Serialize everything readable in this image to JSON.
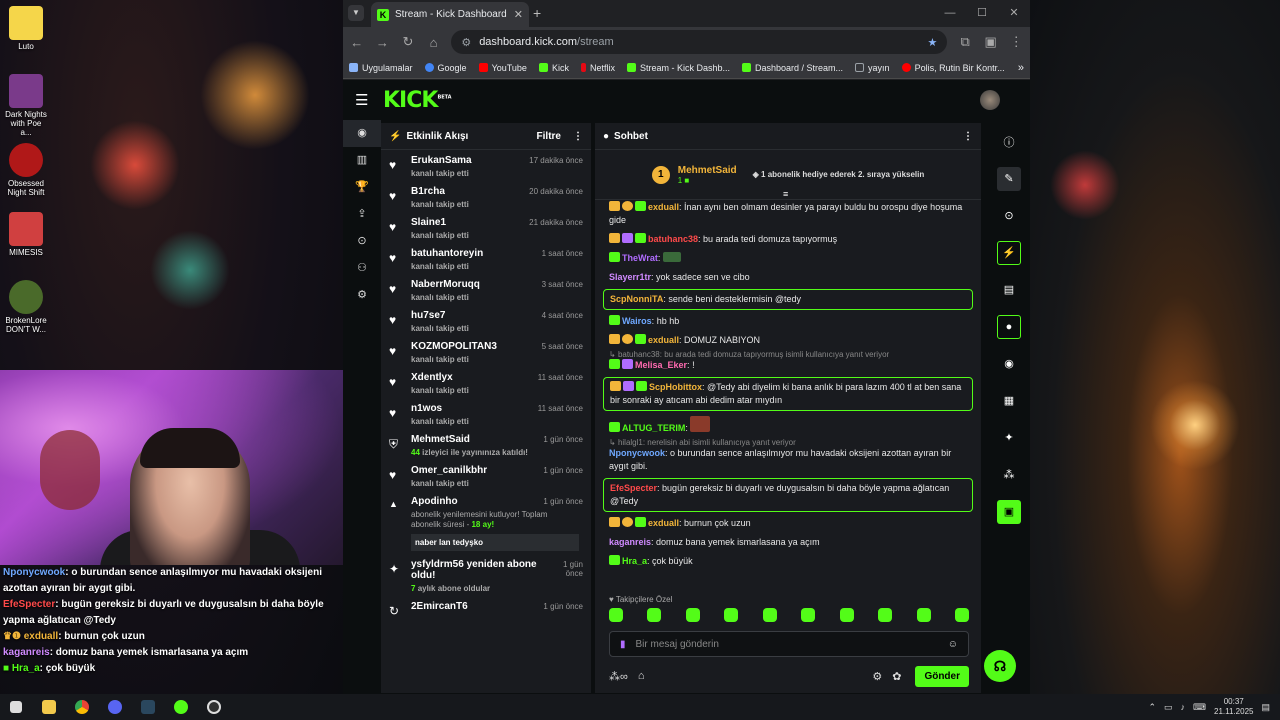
{
  "desktop": {
    "icons": [
      {
        "label": "Luto",
        "color": "#f5d64a"
      },
      {
        "label": "Dark Nights with Poe a...",
        "color": "#7a3a8a"
      },
      {
        "label": "Obsessed Night Shift",
        "color": "#b01818"
      },
      {
        "label": "MIMESIS",
        "color": "#d04040"
      },
      {
        "label": "BrokenLore DON'T W...",
        "color": "#4a6a2a"
      }
    ]
  },
  "overlay_chat": [
    {
      "user": "Nponycwook",
      "text": ": o burundan sence anlaşılmıyor mu havadaki oksijeni azottan ayıran bir aygıt gibi.",
      "color": "#6fa8ff"
    },
    {
      "user": "EfeSpecter",
      "text": ": bugün gereksiz bi duyarlı ve duygusalsın bi daha böyle yapma ağlatıcan @Tedy",
      "color": "#ff4a4a"
    },
    {
      "user": "exduall",
      "text": ": burnun çok uzun",
      "color": "#f2b53a"
    },
    {
      "user": "kaganreis",
      "text": ": domuz bana yemek ismarlasana ya açım",
      "color": "#d08aff"
    },
    {
      "user": "Hra_a",
      "text": ": çok büyük",
      "color": "#53fc18"
    }
  ],
  "browser": {
    "tab_title": "Stream - Kick Dashboard",
    "tab_favicon": "K",
    "url_host": "dashboard.kick.com",
    "url_path": "/stream",
    "bookmarks": [
      {
        "label": "Uygulamalar",
        "color": "#8ab4f8"
      },
      {
        "label": "Google",
        "color": "#4285f4"
      },
      {
        "label": "YouTube",
        "color": "#ff0000"
      },
      {
        "label": "Kick",
        "color": "#53fc18"
      },
      {
        "label": "Netflix",
        "color": "#e50914"
      },
      {
        "label": "Stream - Kick Dashb...",
        "color": "#53fc18"
      },
      {
        "label": "Dashboard / Stream...",
        "color": "#53fc18"
      },
      {
        "label": "yayın",
        "color": "#9aa0a6"
      },
      {
        "label": "Polis, Rutin Bir Kontr...",
        "color": "#ff0000"
      }
    ]
  },
  "kick": {
    "logo": "KICK",
    "logo_badge": "BETA",
    "activity": {
      "title": "Etkinlik Akışı",
      "filter": "Filtre",
      "events": [
        {
          "name": "ErukanSama",
          "sub": "kanalı takip etti",
          "time": "17 dakika önce"
        },
        {
          "name": "B1rcha",
          "sub": "kanalı takip etti",
          "time": "20 dakika önce"
        },
        {
          "name": "Slaine1",
          "sub": "kanalı takip etti",
          "time": "21 dakika önce"
        },
        {
          "name": "batuhantoreyin",
          "sub": "kanalı takip etti",
          "time": "1 saat önce"
        },
        {
          "name": "NaberrMoruqq",
          "sub": "kanalı takip etti",
          "time": "3 saat önce"
        },
        {
          "name": "hu7se7",
          "sub": "kanalı takip etti",
          "time": "4 saat önce"
        },
        {
          "name": "KOZMOPOLITAN3",
          "sub": "kanalı takip etti",
          "time": "5 saat önce"
        },
        {
          "name": "Xdentlyx",
          "sub": "kanalı takip etti",
          "time": "11 saat önce"
        },
        {
          "name": "n1wos",
          "sub": "kanalı takip etti",
          "time": "11 saat önce"
        }
      ],
      "raid": {
        "name": "MehmetSaid",
        "count": "44",
        "sub": "izleyici ile yayınınıza katıldı!",
        "time": "1 gün önce"
      },
      "follow2": {
        "name": "Omer_canilkbhr",
        "sub": "kanalı takip etti",
        "time": "1 gün önce"
      },
      "resub": {
        "name": "Apodinho",
        "time": "1 gün önce",
        "sub": "abonelik yenilemesini kutluyor! Toplam abonelik süresi -",
        "months": "18",
        "months_suffix": "ay!",
        "message": "naber lan tedyşko"
      },
      "resub2": {
        "name": "ysfyldrm56 yeniden abone oldu!",
        "time": "1 gün önce",
        "months": "7",
        "sub": "aylık abone oldular"
      },
      "last": {
        "name": "2EmircanT6",
        "time": "1 gün önce"
      }
    },
    "chat": {
      "title": "Sohbet",
      "pinned_rank": "1",
      "pinned_user": "MehmetSaid",
      "pinned_count": "1",
      "pinned_text": "1 abonelik hediye ederek 2. sıraya yükselin",
      "messages": [
        {
          "user": "exduall",
          "color": "#f2b53a",
          "text": "İnan aynı ben olmam desinler ya parayı buldu bu orospu diye hoşuma gide",
          "hl": false
        },
        {
          "user": "batuhanc38",
          "color": "#ff4a4a",
          "text": "bu arada tedi domuza tapıyormuş",
          "hl": false
        },
        {
          "user": "TheWrat",
          "color": "#b06cff",
          "text": "",
          "hl": false
        },
        {
          "user": "Slayerr1tr",
          "color": "#d08aff",
          "text": "yok sadece sen ve cibo",
          "hl": false
        },
        {
          "user": "ScpNonniTA",
          "color": "#f2b53a",
          "text": "sende beni desteklermisin @tedy",
          "hl": true
        },
        {
          "user": "Wairos",
          "color": "#6fa8ff",
          "text": "hb hb",
          "hl": false
        },
        {
          "user": "exduall",
          "color": "#f2b53a",
          "text": "DOMUZ NABIYON",
          "hl": false
        },
        {
          "reply": "batuhanc38: bu arada tedi domuza tapıyormuş isimli kullanıcıya yanıt veriyor"
        },
        {
          "user": "Melisa_Eker",
          "color": "#ff6ab0",
          "text": "!",
          "hl": false
        },
        {
          "user": "ScpHobittox",
          "color": "#f2b53a",
          "text": "@Tedy abi diyelim ki bana anlık bi para lazım 400 tl at ben sana bir sonraki ay atıcam abi dedim atar mıydın",
          "hl": true
        },
        {
          "user": "ALTUG_TERIM",
          "color": "#53fc18",
          "text": "",
          "hl": false
        },
        {
          "reply": "hilalgl1: nerelisin abi isimli kullanıcıya yanıt veriyor"
        },
        {
          "user": "Nponycwook",
          "color": "#6fa8ff",
          "text": "o burundan sence anlaşılmıyor mu havadaki oksijeni azottan ayıran bir aygıt gibi.",
          "hl": false
        },
        {
          "user": "EfeSpecter",
          "color": "#ff4a4a",
          "text": "bugün gereksiz bi duyarlı ve duygusalsın bi daha böyle yapma ağlatıcan @Tedy",
          "hl": true
        },
        {
          "user": "exduall",
          "color": "#f2b53a",
          "text": "burnun çok uzun",
          "hl": false
        },
        {
          "user": "kaganreis",
          "color": "#d08aff",
          "text": "domuz bana yemek ismarlasana ya açım",
          "hl": false
        },
        {
          "user": "Hra_a",
          "color": "#53fc18",
          "text": "çok büyük",
          "hl": false
        }
      ],
      "follower_only": "Takipçilere Özel",
      "input_placeholder": "Bir mesaj gönderin",
      "send": "Gönder"
    }
  },
  "taskbar": {
    "time": "00:37",
    "date": "21.11.2025"
  }
}
